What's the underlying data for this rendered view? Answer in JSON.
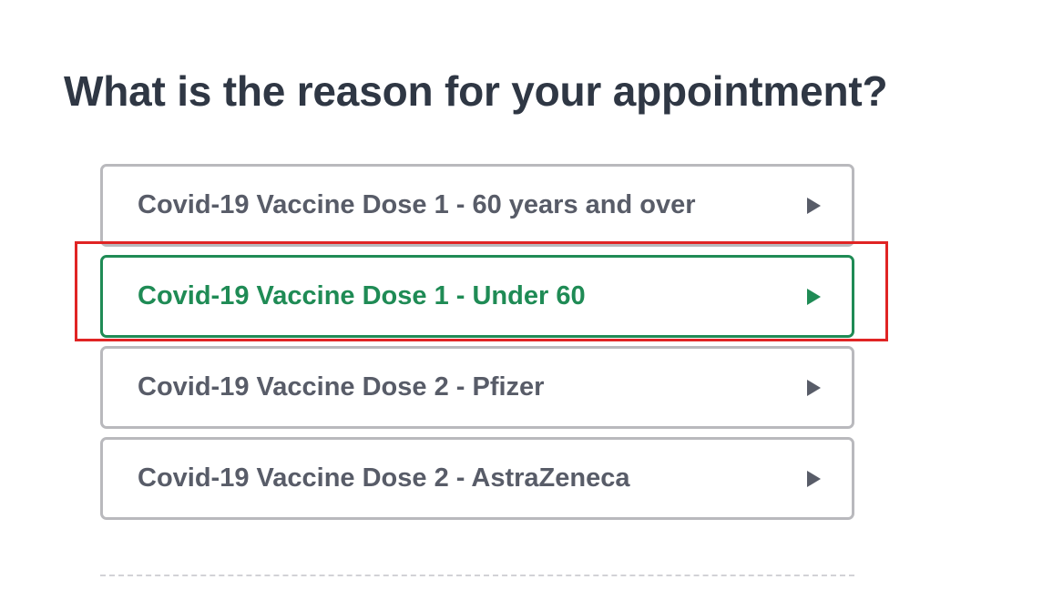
{
  "heading": "What is the reason for your appointment?",
  "options": [
    {
      "label": "Covid-19 Vaccine Dose 1 - 60 years and over",
      "selected": false
    },
    {
      "label": "Covid-19 Vaccine Dose 1 - Under 60",
      "selected": true
    },
    {
      "label": "Covid-19 Vaccine Dose 2 - Pfizer",
      "selected": false
    },
    {
      "label": "Covid-19 Vaccine Dose 2 - AstraZeneca",
      "selected": false
    }
  ],
  "colors": {
    "heading": "#2f3744",
    "option_text": "#585c68",
    "option_border": "#b9b9bd",
    "selected": "#1f8b55",
    "annotation": "#e02424"
  },
  "icons": {
    "option_arrow": "caret-right-icon"
  }
}
